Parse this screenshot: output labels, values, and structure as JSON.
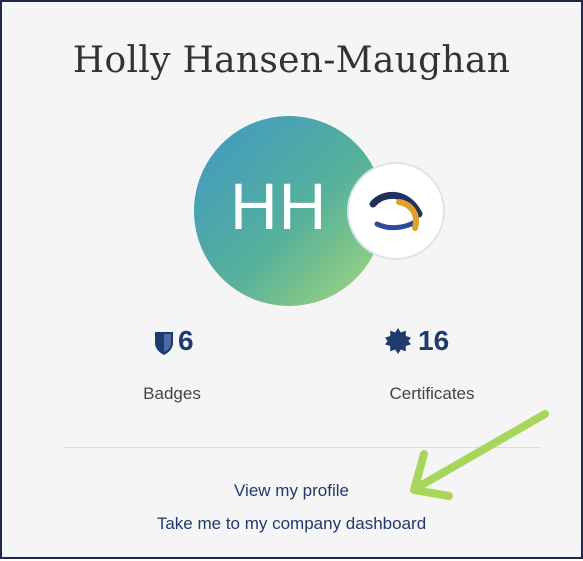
{
  "profile": {
    "name": "Holly Hansen-Maughan",
    "initials": "HH"
  },
  "stats": {
    "badges": {
      "count": "6",
      "label": "Badges",
      "icon": "shield-icon"
    },
    "certificates": {
      "count": "16",
      "label": "Certificates",
      "icon": "seal-icon"
    }
  },
  "links": {
    "view_profile": "View my profile",
    "company_dashboard": "Take me to my company dashboard"
  },
  "colors": {
    "accent": "#1e3a6e",
    "annotation_arrow": "#a8d65c",
    "avatar_gradient": [
      "#3f97c6",
      "#56b19a",
      "#a9d97a"
    ]
  }
}
